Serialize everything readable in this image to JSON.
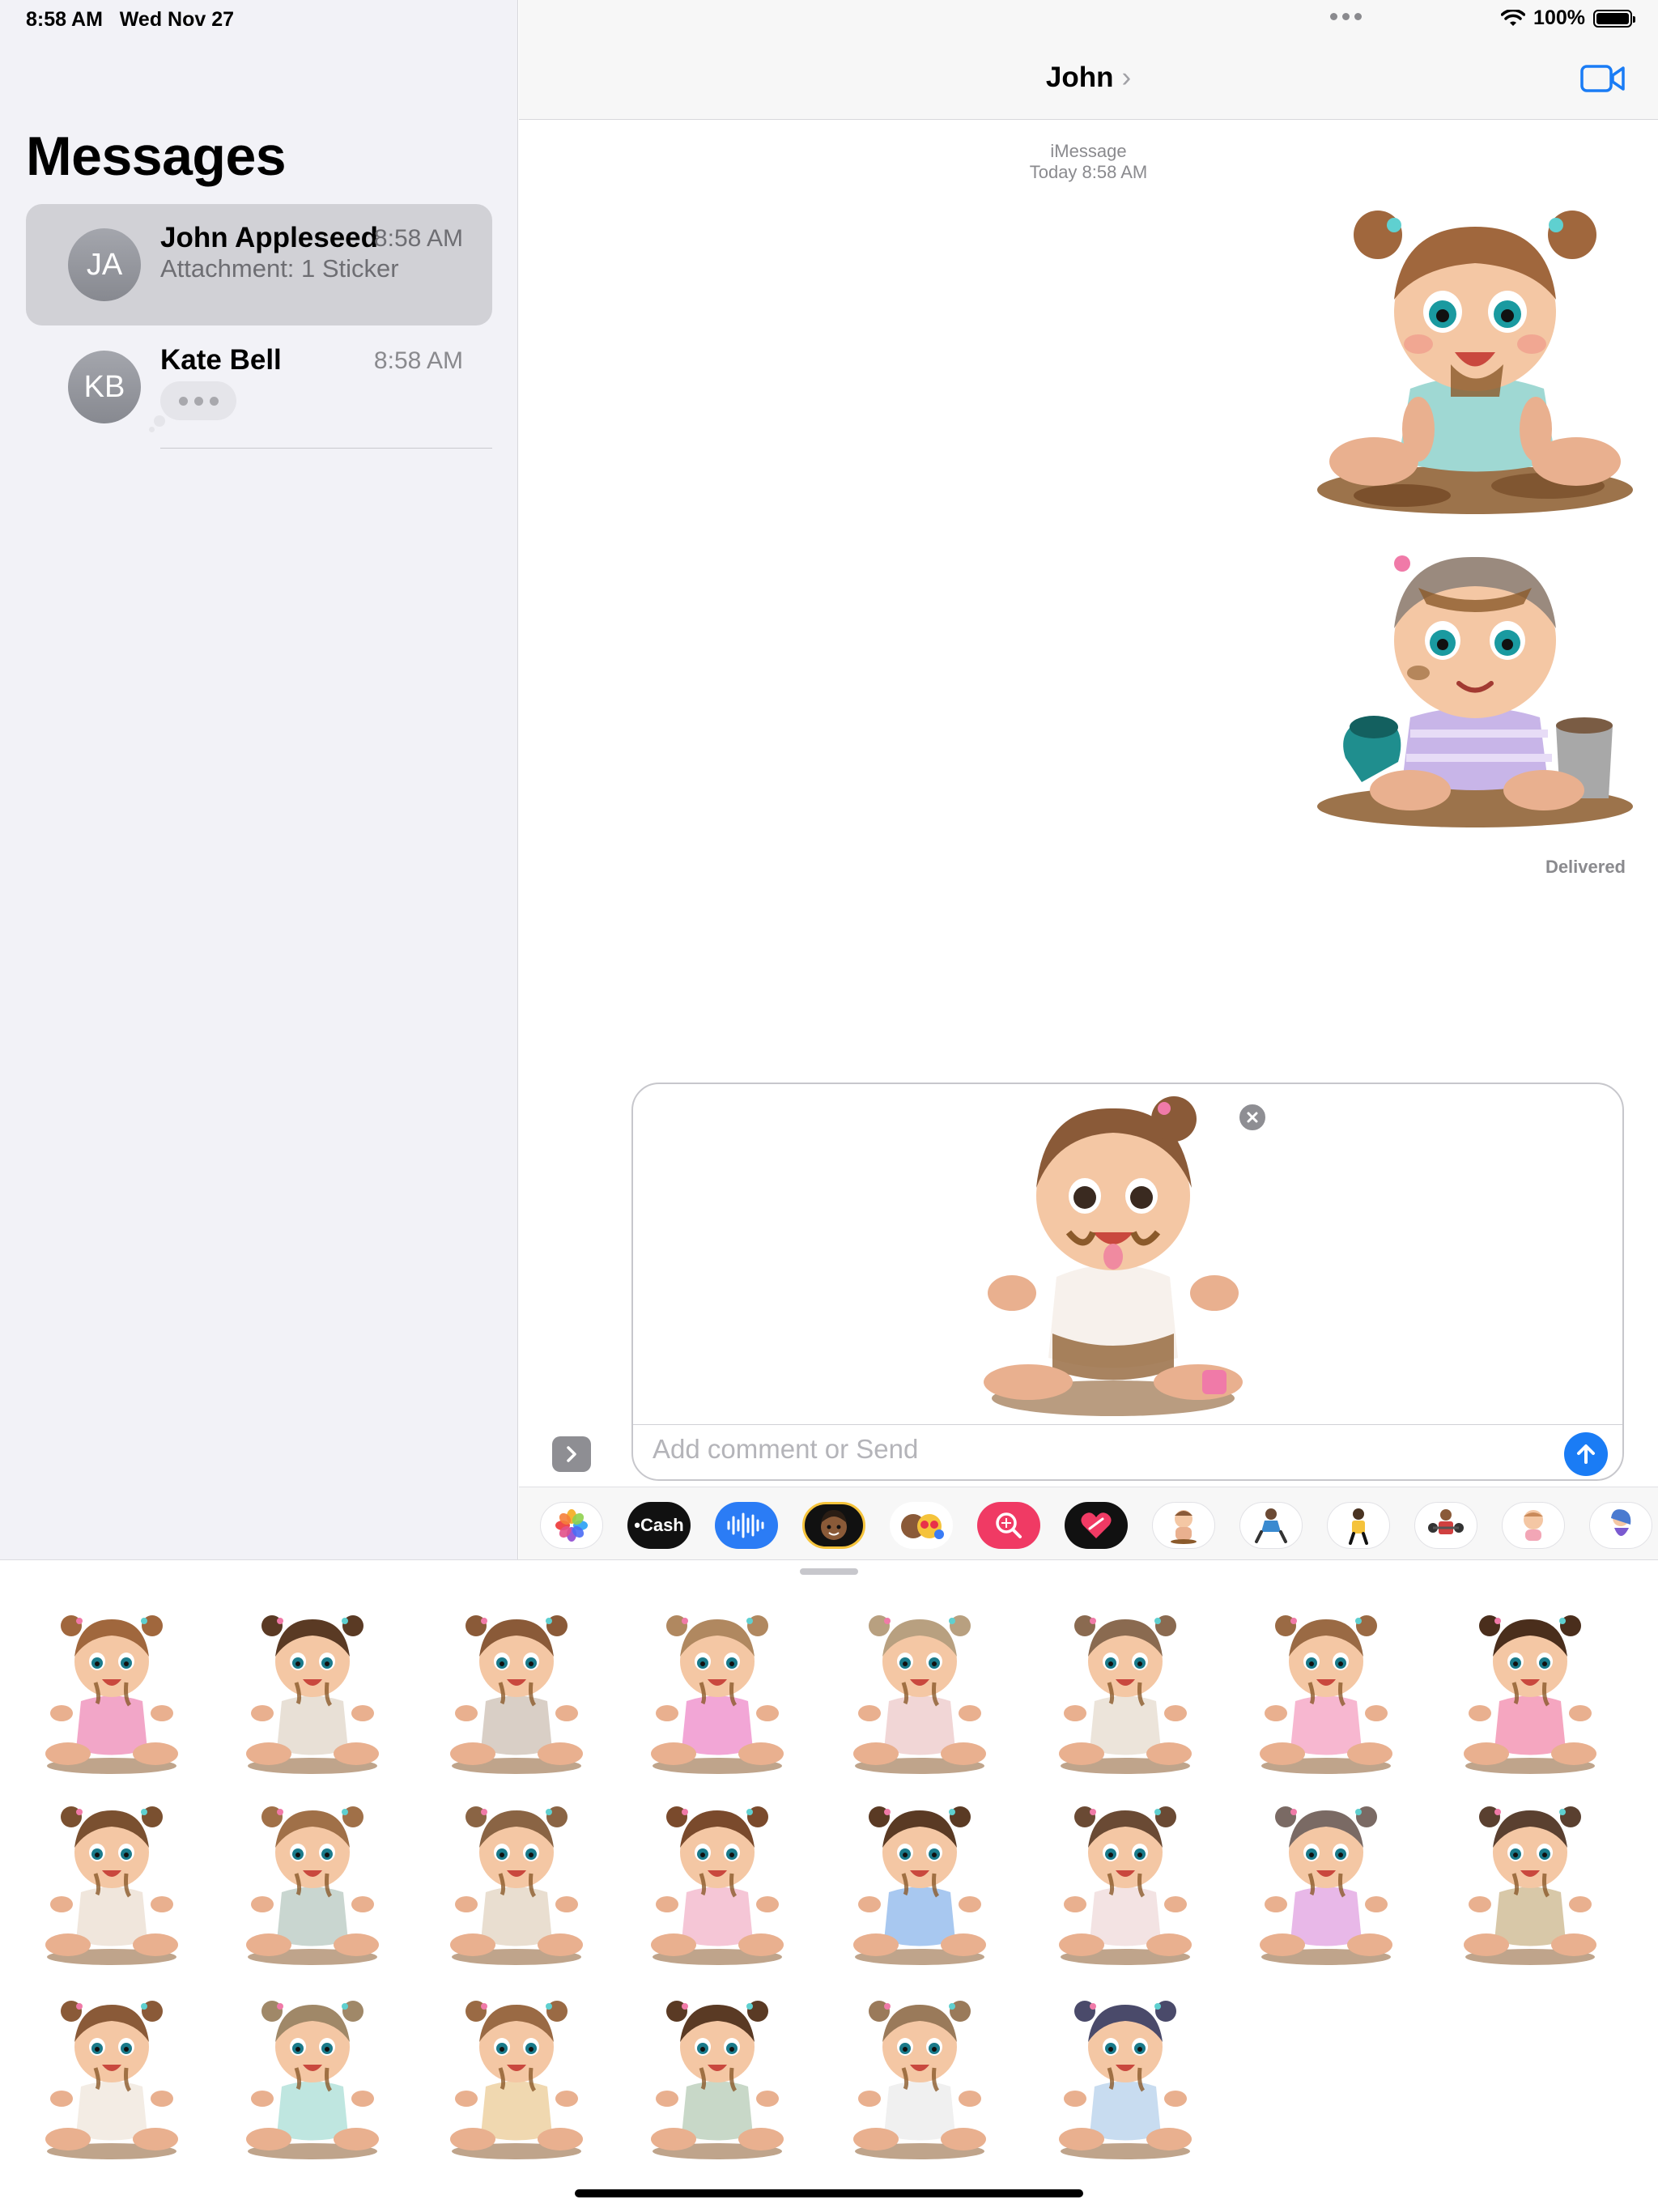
{
  "status_bar": {
    "time": "8:58 AM",
    "date": "Wed Nov 27",
    "battery": "100%",
    "icons": [
      "wifi-icon",
      "battery-icon"
    ]
  },
  "sidebar": {
    "title": "Messages",
    "conversations": [
      {
        "initials": "JA",
        "name": "John Appleseed",
        "time": "8:58 AM",
        "preview": "Attachment: 1 Sticker",
        "selected": true
      },
      {
        "initials": "KB",
        "name": "Kate Bell",
        "time": "8:58 AM",
        "preview": "",
        "typing": true,
        "selected": false
      }
    ]
  },
  "chat": {
    "title": "John",
    "service": "iMessage",
    "timestamp": "Today 8:58 AM",
    "messages": [
      {
        "type": "sticker",
        "subject": "baby girl with pigtails sitting in mud, teal shirt"
      },
      {
        "type": "sticker",
        "subject": "baby sitting in mud with paint buckets, lavender shirt"
      }
    ],
    "status": "Delivered"
  },
  "compose": {
    "placeholder": "Add comment or Send",
    "attachment": {
      "type": "sticker",
      "subject": "baby in white outfit covered in chocolate"
    }
  },
  "app_strip": {
    "cash_label": "Cash",
    "apps": [
      "photos-app-icon",
      "apple-cash-app-icon",
      "audio-message-app-icon",
      "memoji-app-icon",
      "memoji-stickers-app-icon",
      "image-search-app-icon",
      "digital-touch-app-icon",
      "sticker-pack-app-icon",
      "sticker-pack-app-icon",
      "sticker-pack-app-icon",
      "sticker-pack-app-icon",
      "sticker-pack-app-icon",
      "sticker-pack-app-icon"
    ]
  },
  "sticker_drawer": {
    "count": 22,
    "rows": 3
  },
  "colors": {
    "accent": "#1a7cf5",
    "sidebar_bg": "#f2f2f7",
    "selected_row": "#d1d1d6",
    "secondary_text": "#8a8a8e"
  }
}
